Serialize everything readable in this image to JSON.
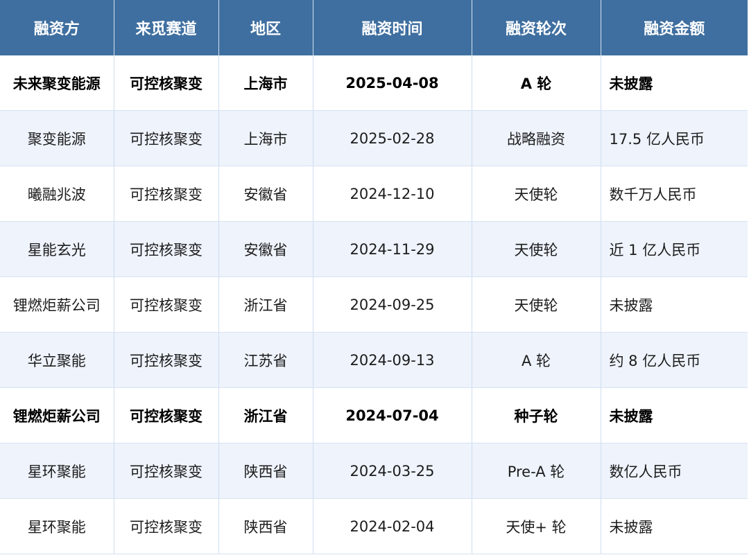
{
  "columns": [
    "融资方",
    "来觅赛道",
    "地区",
    "融资时间",
    "融资轮次",
    "融资金额"
  ],
  "rows": [
    {
      "company": "未来聚变能源",
      "track": "可控核聚变",
      "region": "上海市",
      "date": "2025-04-08",
      "round": "A 轮",
      "amount": "未披露",
      "bold": true
    },
    {
      "company": "聚变能源",
      "track": "可控核聚变",
      "region": "上海市",
      "date": "2025-02-28",
      "round": "战略融资",
      "amount": "17.5 亿人民币",
      "bold": false
    },
    {
      "company": "曦融兆波",
      "track": "可控核聚变",
      "region": "安徽省",
      "date": "2024-12-10",
      "round": "天使轮",
      "amount": "数千万人民币",
      "bold": false
    },
    {
      "company": "星能玄光",
      "track": "可控核聚变",
      "region": "安徽省",
      "date": "2024-11-29",
      "round": "天使轮",
      "amount": "近 1 亿人民币",
      "bold": false
    },
    {
      "company": "锂燃炬薪公司",
      "track": "可控核聚变",
      "region": "浙江省",
      "date": "2024-09-25",
      "round": "天使轮",
      "amount": "未披露",
      "bold": false
    },
    {
      "company": "华立聚能",
      "track": "可控核聚变",
      "region": "江苏省",
      "date": "2024-09-13",
      "round": "A 轮",
      "amount": "约 8 亿人民币",
      "bold": false
    },
    {
      "company": "锂燃炬薪公司",
      "track": "可控核聚变",
      "region": "浙江省",
      "date": "2024-07-04",
      "round": "种子轮",
      "amount": "未披露",
      "bold": true
    },
    {
      "company": "星环聚能",
      "track": "可控核聚变",
      "region": "陕西省",
      "date": "2024-03-25",
      "round": "Pre-A 轮",
      "amount": "数亿人民币",
      "bold": false
    },
    {
      "company": "星环聚能",
      "track": "可控核聚变",
      "region": "陕西省",
      "date": "2024-02-04",
      "round": "天使+ 轮",
      "amount": "未披露",
      "bold": false
    }
  ]
}
